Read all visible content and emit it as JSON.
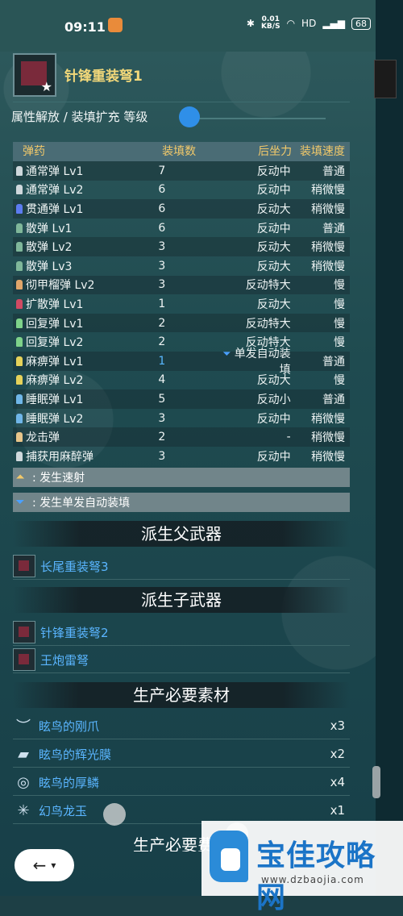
{
  "status_bar": {
    "time": "09:11",
    "net_speed": "0.01",
    "net_unit": "KB/S",
    "hd": "HD",
    "signal": "4G",
    "battery": "68"
  },
  "weapon": {
    "name": "针锋重装弩1"
  },
  "attribute": {
    "label": "属性解放 / 装填扩充 等级",
    "level": 0
  },
  "table": {
    "headers": [
      "弹药",
      "装填数",
      "后坐力",
      "装填速度"
    ],
    "rows": [
      {
        "name": "通常弹 Lv1",
        "count": "7",
        "recoil": "反动中",
        "speed": "普通",
        "color": "#cfd8dc"
      },
      {
        "name": "通常弹 Lv2",
        "count": "6",
        "recoil": "反动中",
        "speed": "稍微慢",
        "color": "#cfd8dc"
      },
      {
        "name": "贯通弹 Lv1",
        "count": "6",
        "recoil": "反动大",
        "speed": "稍微慢",
        "color": "#5c7cf0"
      },
      {
        "name": "散弹 Lv1",
        "count": "6",
        "recoil": "反动中",
        "speed": "普通",
        "color": "#7fb79a"
      },
      {
        "name": "散弹 Lv2",
        "count": "3",
        "recoil": "反动大",
        "speed": "稍微慢",
        "color": "#7fb79a"
      },
      {
        "name": "散弹 Lv3",
        "count": "3",
        "recoil": "反动大",
        "speed": "稍微慢",
        "color": "#7fb79a"
      },
      {
        "name": "彻甲榴弹 Lv2",
        "count": "3",
        "recoil": "反动特大",
        "speed": "慢",
        "color": "#e0a56a"
      },
      {
        "name": "扩散弹 Lv1",
        "count": "1",
        "recoil": "反动大",
        "speed": "慢",
        "color": "#d04a63"
      },
      {
        "name": "回复弹 Lv1",
        "count": "2",
        "recoil": "反动特大",
        "speed": "慢",
        "color": "#7ed28a"
      },
      {
        "name": "回复弹 Lv2",
        "count": "2",
        "recoil": "反动特大",
        "speed": "慢",
        "color": "#7ed28a"
      },
      {
        "name": "麻痹弹 Lv1",
        "count": "1",
        "recoil": "单发自动装填",
        "speed": "普通",
        "color": "#e6d25a",
        "auto": true
      },
      {
        "name": "麻痹弹 Lv2",
        "count": "4",
        "recoil": "反动大",
        "speed": "慢",
        "color": "#e6d25a"
      },
      {
        "name": "睡眠弹 Lv1",
        "count": "5",
        "recoil": "反动小",
        "speed": "普通",
        "color": "#6fb6e8"
      },
      {
        "name": "睡眠弹 Lv2",
        "count": "3",
        "recoil": "反动中",
        "speed": "稍微慢",
        "color": "#6fb6e8"
      },
      {
        "name": "龙击弹",
        "count": "2",
        "recoil": "-",
        "speed": "稍微慢",
        "color": "#e7c58a"
      },
      {
        "name": "捕获用麻醉弹",
        "count": "3",
        "recoil": "反动中",
        "speed": "稍微慢",
        "color": "#cfd8dc"
      }
    ]
  },
  "legend": {
    "rapid": "发生速射",
    "auto_reload": "发生单发自动装填"
  },
  "parent": {
    "title": "派生父武器",
    "items": [
      "长尾重装弩3"
    ]
  },
  "child": {
    "title": "派生子武器",
    "items": [
      "针锋重装弩2",
      "王炮雷弩"
    ]
  },
  "materials": {
    "title": "生产必要素材",
    "items": [
      {
        "name": "眩鸟的刚爪",
        "qty": "x3",
        "icon": "claw-icon"
      },
      {
        "name": "眩鸟的辉光膜",
        "qty": "x2",
        "icon": "membrane-icon"
      },
      {
        "name": "眩鸟的厚鳞",
        "qty": "x4",
        "icon": "scale-icon"
      },
      {
        "name": "幻鸟龙玉",
        "qty": "x1",
        "icon": "gem-icon"
      }
    ]
  },
  "cost": {
    "title": "生产必要费用"
  },
  "watermark": {
    "title": "宝佳攻略网",
    "url": "www.dzbaojia.com"
  }
}
